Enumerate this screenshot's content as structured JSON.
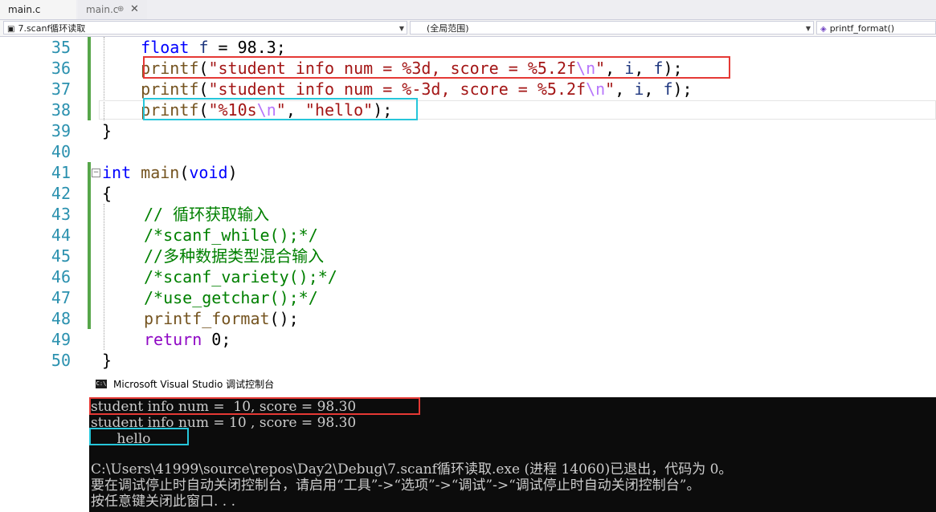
{
  "tabs": [
    {
      "label": "main.c",
      "active": true
    },
    {
      "label": "main.c",
      "active": false,
      "pin": "⊕",
      "close": "✕"
    }
  ],
  "navbar": {
    "project": "7.scanf循环读取",
    "scope": "(全局范围)",
    "function": "printf_format()"
  },
  "editor": {
    "line_numbers": [
      "35",
      "36",
      "37",
      "38",
      "39",
      "40",
      "41",
      "42",
      "43",
      "44",
      "45",
      "46",
      "47",
      "48",
      "49",
      "50"
    ],
    "lines": {
      "l35": {
        "type": "float",
        "name": "f",
        "rest": " = 98.3;"
      },
      "l36": {
        "fn": "printf",
        "str1": "\"student info num = %3d, score = %5.2f",
        "esc": "\\n",
        "str2": "\"",
        "args_pre": ", ",
        "a1": "i",
        "sep": ", ",
        "a2": "f",
        "end": ");"
      },
      "l37": {
        "fn": "printf",
        "str1": "\"student info num = %-3d, score = %5.2f",
        "esc": "\\n",
        "str2": "\"",
        "args_pre": ", ",
        "a1": "i",
        "sep": ", ",
        "a2": "f",
        "end": ");"
      },
      "l38": {
        "fn": "printf",
        "str1": "\"%10s",
        "esc": "\\n",
        "str2": "\"",
        "args_pre": ", ",
        "a1": "\"hello\"",
        "end": ");"
      },
      "l39": "}",
      "l41": {
        "type": "int",
        "fn": "main",
        "open": "(",
        "param": "void",
        "close": ")"
      },
      "l42": "{",
      "l43": "// 循环获取输入",
      "l44": "/*scanf_while();*/",
      "l45": "//多种数据类型混合输入",
      "l46": "/*scanf_variety();*/",
      "l47": "/*use_getchar();*/",
      "l48": {
        "fn": "printf_format",
        "rest": "();"
      },
      "l49": {
        "kw": "return",
        "rest": " 0;"
      },
      "l50": "}"
    }
  },
  "console": {
    "title": "Microsoft Visual Studio 调试控制台",
    "icon": "C:\\",
    "lines": [
      "student info num =  10, score = 98.30",
      "student info num = 10 , score = 98.30",
      "      hello",
      "",
      "C:\\Users\\41999\\source\\repos\\Day2\\Debug\\7.scanf循环读取.exe (进程 14060)已退出，代码为 0。",
      "要在调试停止时自动关闭控制台，请启用“工具”->“选项”->“调试”->“调试停止时自动关闭控制台”。",
      "按任意键关闭此窗口. . ."
    ]
  },
  "colors": {
    "highlight_red": "#e53935",
    "highlight_cyan": "#26c6da",
    "keyword": "#0000ff",
    "string": "#a31515",
    "comment": "#008000",
    "line_number": "#2b91af"
  }
}
